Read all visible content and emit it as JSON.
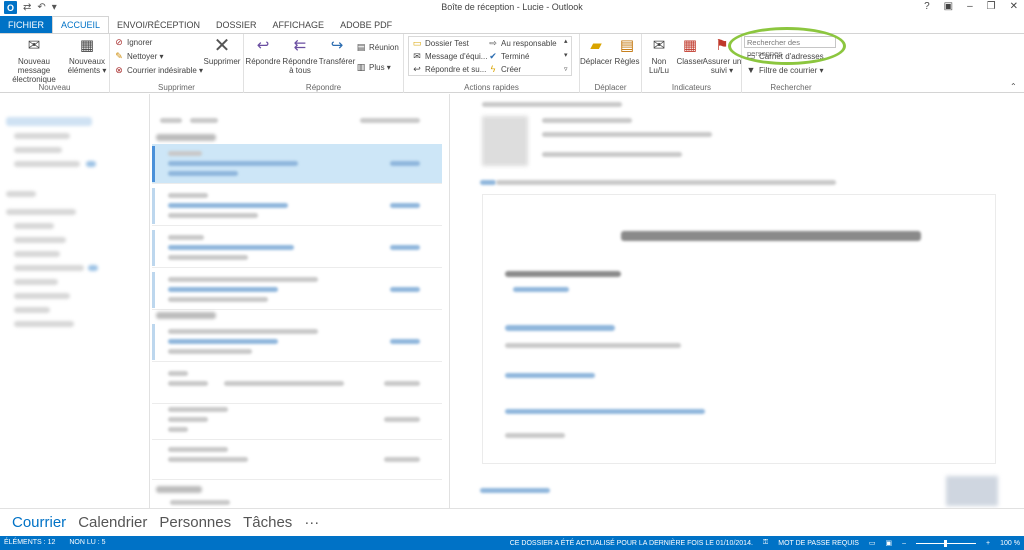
{
  "window": {
    "title": "Boîte de réception - Lucie - Outlook",
    "app_icon": "O",
    "controls": [
      "?",
      "▣",
      "–",
      "❐",
      "✕"
    ]
  },
  "tabs": [
    {
      "label": "FICHIER",
      "state": "file"
    },
    {
      "label": "ACCUEIL",
      "state": "active"
    },
    {
      "label": "ENVOI/RÉCEPTION",
      "state": ""
    },
    {
      "label": "DOSSIER",
      "state": ""
    },
    {
      "label": "AFFICHAGE",
      "state": ""
    },
    {
      "label": "ADOBE PDF",
      "state": ""
    }
  ],
  "ribbon": {
    "nouveau": {
      "label": "Nouveau",
      "new_message_l1": "Nouveau message",
      "new_message_l2": "électronique",
      "new_items_l1": "Nouveaux",
      "new_items_l2": "éléments ▾"
    },
    "supprimer": {
      "label": "Supprimer",
      "ignore": "Ignorer",
      "cleanup": "Nettoyer ▾",
      "junk": "Courrier indésirable ▾",
      "delete": "Supprimer"
    },
    "repondre": {
      "label": "Répondre",
      "reply": "Répondre",
      "reply_all_l1": "Répondre",
      "reply_all_l2": "à tous",
      "forward": "Transférer",
      "meeting": "Réunion",
      "more": "Plus ▾"
    },
    "actions_rapides": {
      "label": "Actions rapides",
      "items": [
        "Dossier Test",
        "Au responsable",
        "Message d'équi...",
        "Terminé",
        "Répondre et su...",
        "Créer"
      ]
    },
    "deplacer": {
      "label": "Déplacer",
      "move": "Déplacer",
      "rules": "Règles"
    },
    "indicateurs": {
      "label": "Indicateurs",
      "unread_l1": "Non",
      "unread_l2": "Lu/Lu",
      "categorize": "Classer",
      "followup_l1": "Assurer un",
      "followup_l2": "suivi ▾"
    },
    "rechercher": {
      "label": "Rechercher",
      "search_people_placeholder": "Rechercher des personnes",
      "address_book": "Carnet d'adresses",
      "filter_mail": "Filtre de courrier ▾"
    }
  },
  "navigation": [
    "Courrier",
    "Calendrier",
    "Personnes",
    "Tâches",
    "···"
  ],
  "status": {
    "items": "ÉLÉMENTS : 12",
    "unread": "NON LU : 5",
    "updated": "CE DOSSIER A ÉTÉ ACTUALISÉ POUR LA DERNIÈRE FOIS LE 01/10/2014.",
    "password": "MOT DE PASSE REQUIS",
    "zoom": "100 %"
  },
  "colors": {
    "accent": "#0072c6",
    "highlight": "#8cc63f"
  }
}
